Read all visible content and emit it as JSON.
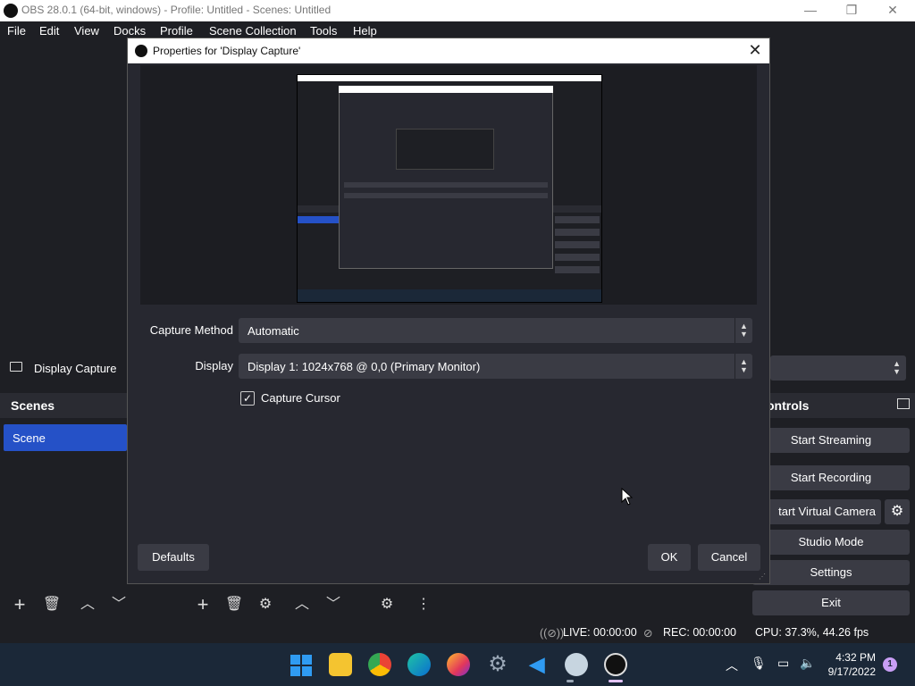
{
  "window": {
    "title": "OBS 28.0.1 (64-bit, windows) - Profile: Untitled - Scenes: Untitled",
    "minimize": "—",
    "maximize": "❐",
    "close": "✕"
  },
  "menu": [
    "File",
    "Edit",
    "View",
    "Docks",
    "Profile",
    "Scene Collection",
    "Tools",
    "Help"
  ],
  "source_bar": {
    "label": "Display Capture"
  },
  "scenes": {
    "title": "Scenes",
    "items": [
      "Scene"
    ]
  },
  "controls": {
    "title": "ontrols",
    "buttons": [
      "Start Streaming",
      "Start Recording",
      "tart Virtual Camera",
      "Studio Mode",
      "Settings",
      "Exit"
    ]
  },
  "status": {
    "live": "LIVE: 00:00:00",
    "rec": "REC: 00:00:00",
    "cpu": "CPU: 37.3%, 44.26 fps"
  },
  "dialog": {
    "title": "Properties for 'Display Capture'",
    "close": "✕",
    "capture_method_label": "Capture Method",
    "capture_method_value": "Automatic",
    "display_label": "Display",
    "display_value": "Display 1: 1024x768 @ 0,0 (Primary Monitor)",
    "capture_cursor_label": "Capture Cursor",
    "capture_cursor_checked": true,
    "defaults_button": "Defaults",
    "ok_button": "OK",
    "cancel_button": "Cancel"
  },
  "taskbar": {
    "time": "4:32 PM",
    "date": "9/17/2022",
    "notifications": "1",
    "apps": [
      "start-icon",
      "file-explorer-icon",
      "chrome-icon",
      "edge-icon",
      "firefox-icon",
      "settings-icon",
      "vscode-icon",
      "steam-icon",
      "obs-icon"
    ]
  },
  "colors": {
    "accent": "#2551c7",
    "background": "#1e1f24",
    "dialog": "#272830",
    "control": "#3a3b44",
    "taskbar": "#1b2838"
  }
}
